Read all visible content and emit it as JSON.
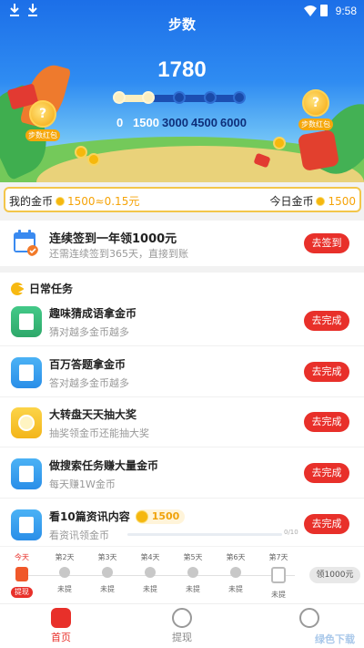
{
  "status_bar": {
    "time": "9:58"
  },
  "header": {
    "title": "步数",
    "steps": "1780",
    "milestones": [
      "0",
      "1500",
      "3000",
      "4500",
      "6000"
    ],
    "progress_reached_fraction": 0.3,
    "left_redpack_label": "步数红包",
    "right_redpack_label": "步数红包",
    "redpack_mark": "?"
  },
  "gold": {
    "my_label": "我的金币",
    "my_value": "1500≈0.15元",
    "today_label": "今日金币",
    "today_value": "1500"
  },
  "signin": {
    "title": "连续签到一年领1000元",
    "subtitle": "还需连续签到365天，直接到账",
    "button": "去签到"
  },
  "daily": {
    "heading": "日常任务",
    "tasks": [
      {
        "title": "趣味猜成语拿金币",
        "desc": "猜对越多金币越多",
        "button": "去完成"
      },
      {
        "title": "百万答题拿金币",
        "desc": "答对越多金币越多",
        "button": "去完成"
      },
      {
        "title": "大转盘天天抽大奖",
        "desc": "抽奖领金币还能抽大奖",
        "button": "去完成"
      },
      {
        "title": "做搜索任务赚大量金币",
        "desc": "每天赚1W金币",
        "button": "去完成"
      },
      {
        "title": "看10篇资讯内容",
        "desc": "看资讯领金币",
        "button": "去完成",
        "coin_reward": "1500",
        "progress": "0/10"
      }
    ]
  },
  "days": {
    "items": [
      {
        "label": "今天",
        "status": "提现"
      },
      {
        "label": "第2天",
        "status": "未提"
      },
      {
        "label": "第3天",
        "status": "未提"
      },
      {
        "label": "第4天",
        "status": "未提"
      },
      {
        "label": "第5天",
        "status": "未提"
      },
      {
        "label": "第6天",
        "status": "未提"
      },
      {
        "label": "第7天",
        "status": "未提"
      }
    ],
    "reward": "领1000元"
  },
  "nav": {
    "home": "首页",
    "cash": "提现"
  },
  "watermark": "绿色下载",
  "colors": {
    "primary_blue": "#2f8cf2",
    "accent_red": "#e8302a",
    "coin_gold": "#f5b70f"
  }
}
